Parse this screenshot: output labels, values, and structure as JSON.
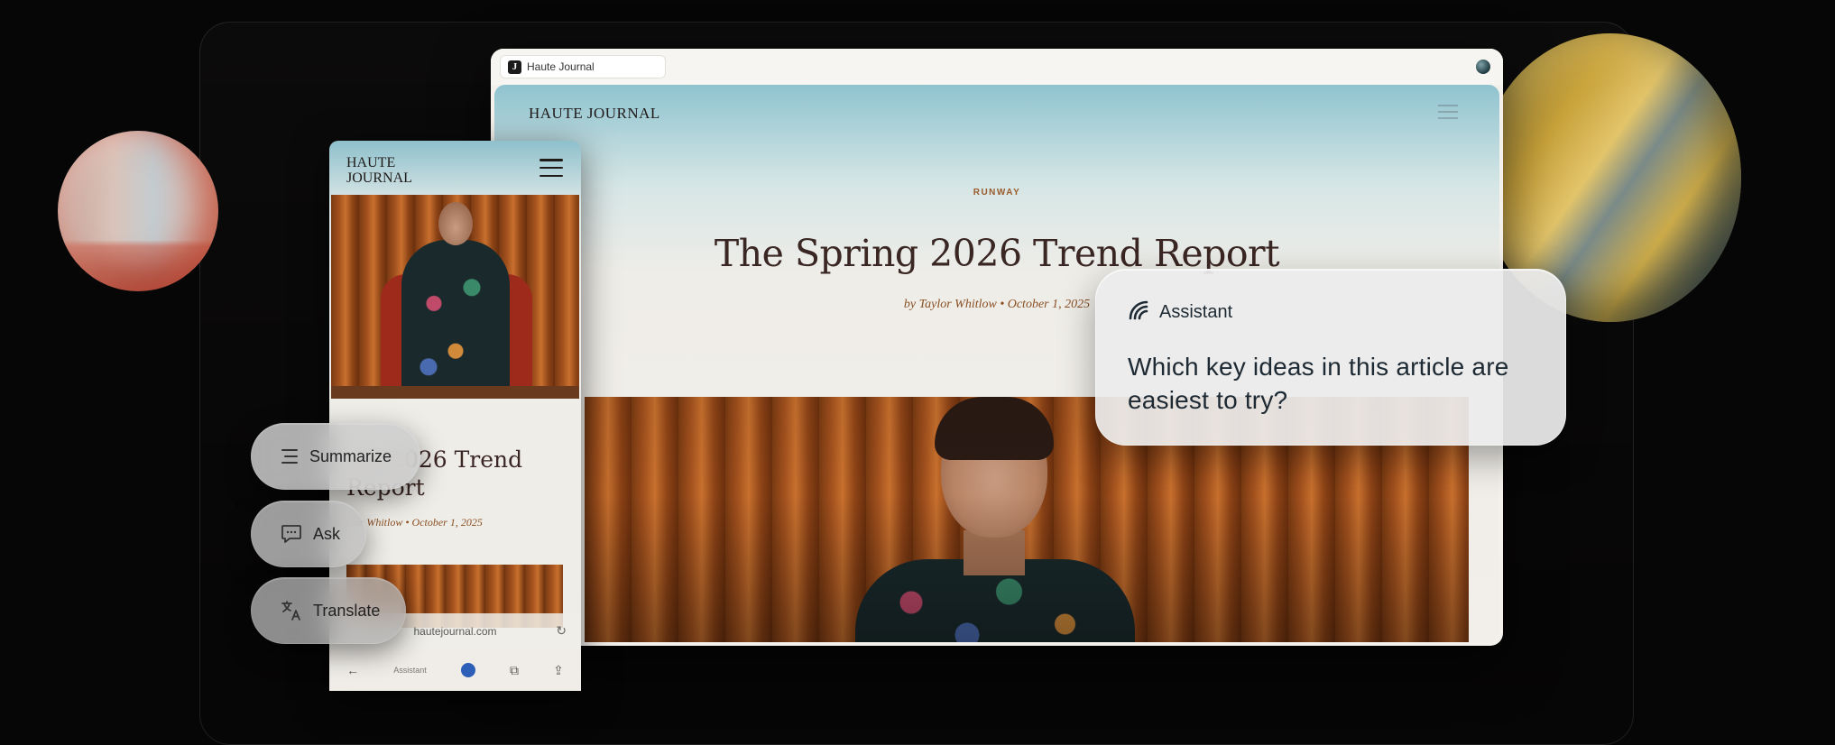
{
  "browser": {
    "tab_title": "Haute Journal",
    "favicon_letter": "J"
  },
  "article": {
    "site_logo": "HAUTE JOURNAL",
    "kicker": "RUNWAY",
    "headline": "The Spring 2026 Trend Report",
    "byline": "by Taylor Whitlow • October 1, 2025"
  },
  "mobile": {
    "logo": "HAUTE JOURNAL",
    "headline_visible": "ing 2026 Trend Report",
    "byline_visible": "ylor Whitlow • October 1, 2025",
    "address": "hautejournal.com",
    "assistant_label": "Assistant"
  },
  "actions": {
    "summarize": "Summarize",
    "ask": "Ask",
    "translate": "Translate"
  },
  "assistant": {
    "title": "Assistant",
    "question": "Which key ideas in this article are easiest to try?"
  },
  "colors": {
    "accent_kicker": "#9a5a2a",
    "headline": "#3a2622",
    "assistant_text": "#1e2a33"
  },
  "icons": [
    "summarize-icon",
    "ask-icon",
    "translate-icon",
    "assistant-logo-icon",
    "menu-icon",
    "reload-icon",
    "back-icon",
    "share-icon",
    "tabs-icon"
  ]
}
